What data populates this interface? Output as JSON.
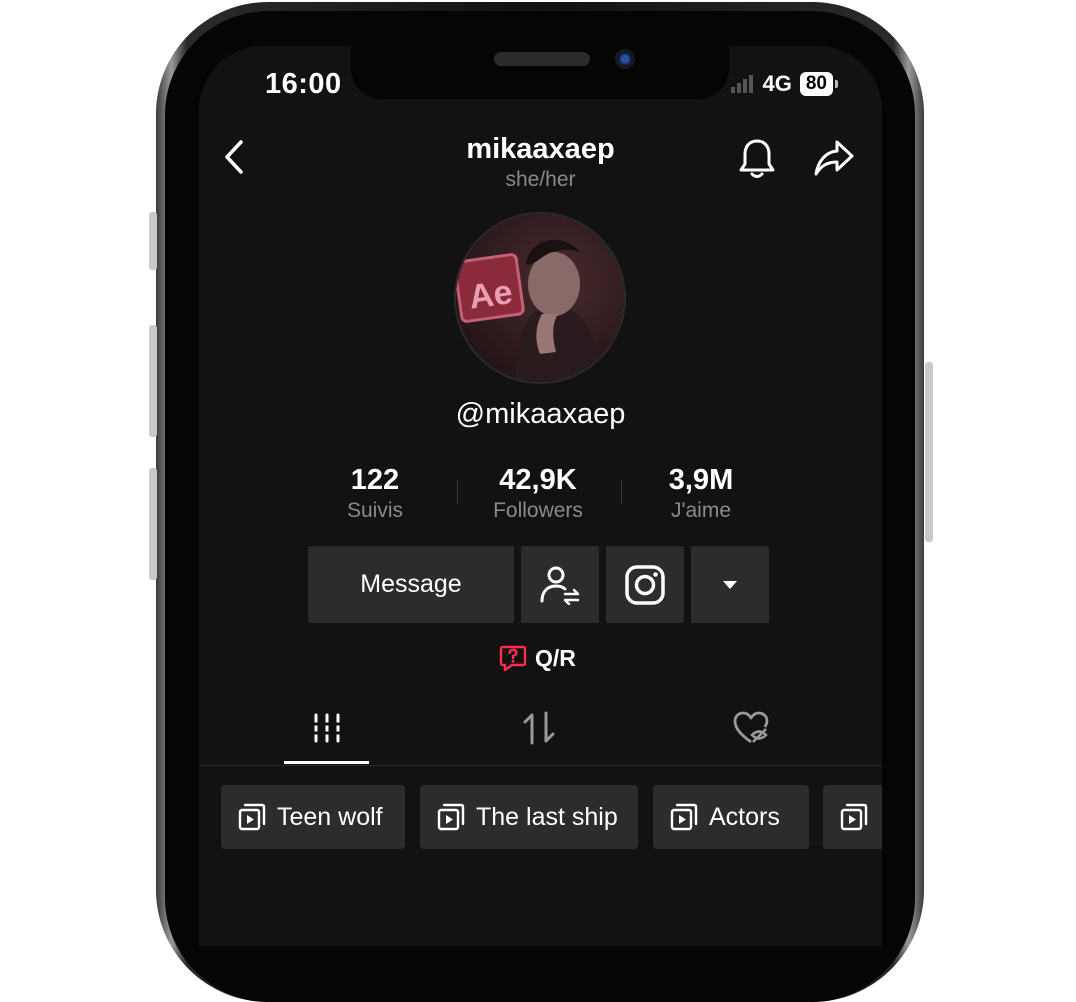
{
  "status_bar": {
    "time": "16:00",
    "network": "4G",
    "battery": "80"
  },
  "header": {
    "username": "mikaaxaep",
    "pronouns": "she/her"
  },
  "profile": {
    "handle": "@mikaaxaep",
    "avatar_text": "Ae",
    "stats": [
      {
        "value": "122",
        "label": "Suivis"
      },
      {
        "value": "42,9K",
        "label": "Followers"
      },
      {
        "value": "3,9M",
        "label": "J'aime"
      }
    ]
  },
  "actions": {
    "message_label": "Message",
    "qa_label": "Q/R"
  },
  "playlists": [
    {
      "label": "Teen wolf"
    },
    {
      "label": "The last ship"
    },
    {
      "label": "Actors"
    }
  ],
  "colors": {
    "background": "#121212",
    "button": "#2c2c2c",
    "accent": "#fe2c55",
    "muted": "#8a8a8a"
  }
}
